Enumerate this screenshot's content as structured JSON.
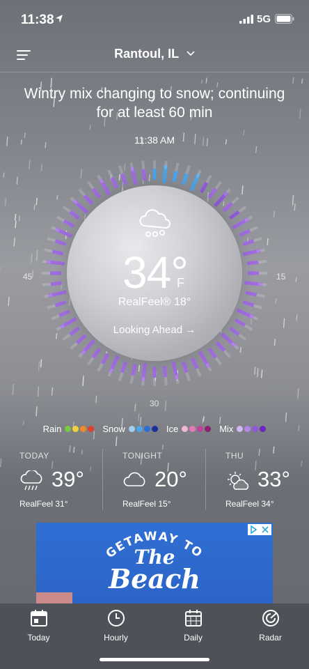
{
  "status_bar": {
    "time": "11:38",
    "network": "5G"
  },
  "header": {
    "location": "Rantoul, IL"
  },
  "summary": "Wintry mix changing to snow; continuing for at least 60 min",
  "current": {
    "time": "11:38 AM",
    "temperature": "34°",
    "unit": "F",
    "realfeel": "RealFeel® 18°",
    "looking_ahead": "Looking Ahead →",
    "dial_labels": {
      "left": "45",
      "right": "15",
      "bottom": "30"
    },
    "icon": "cloud-snow-icon"
  },
  "legend": [
    {
      "label": "Rain",
      "colors": [
        "#7ac943",
        "#f2d03b",
        "#f08a2a",
        "#e0402a"
      ]
    },
    {
      "label": "Snow",
      "colors": [
        "#9fd0f2",
        "#4ea6e8",
        "#2a6fd6",
        "#1a2f9a"
      ]
    },
    {
      "label": "Ice",
      "colors": [
        "#f0b8d8",
        "#e07ab8",
        "#c0409a",
        "#8a2070"
      ]
    },
    {
      "label": "Mix",
      "colors": [
        "#d0b8f0",
        "#b088e8",
        "#9058d8",
        "#6a28c0"
      ]
    }
  ],
  "forecast": [
    {
      "label": "TODAY",
      "temp": "39°",
      "realfeel": "RealFeel 31°",
      "icon": "cloud-rain-icon"
    },
    {
      "label": "TONIGHT",
      "temp": "20°",
      "realfeel": "RealFeel 15°",
      "icon": "cloud-icon"
    },
    {
      "label": "THU",
      "temp": "33°",
      "realfeel": "RealFeel 34°",
      "icon": "partly-sunny-icon"
    }
  ],
  "ad": {
    "line1": "GETAWAY TO",
    "line2": "The",
    "line3": "Beach"
  },
  "tabs": [
    {
      "label": "Today",
      "icon": "calendar-today-icon"
    },
    {
      "label": "Hourly",
      "icon": "clock-icon"
    },
    {
      "label": "Daily",
      "icon": "calendar-icon"
    },
    {
      "label": "Radar",
      "icon": "radar-icon"
    }
  ]
}
